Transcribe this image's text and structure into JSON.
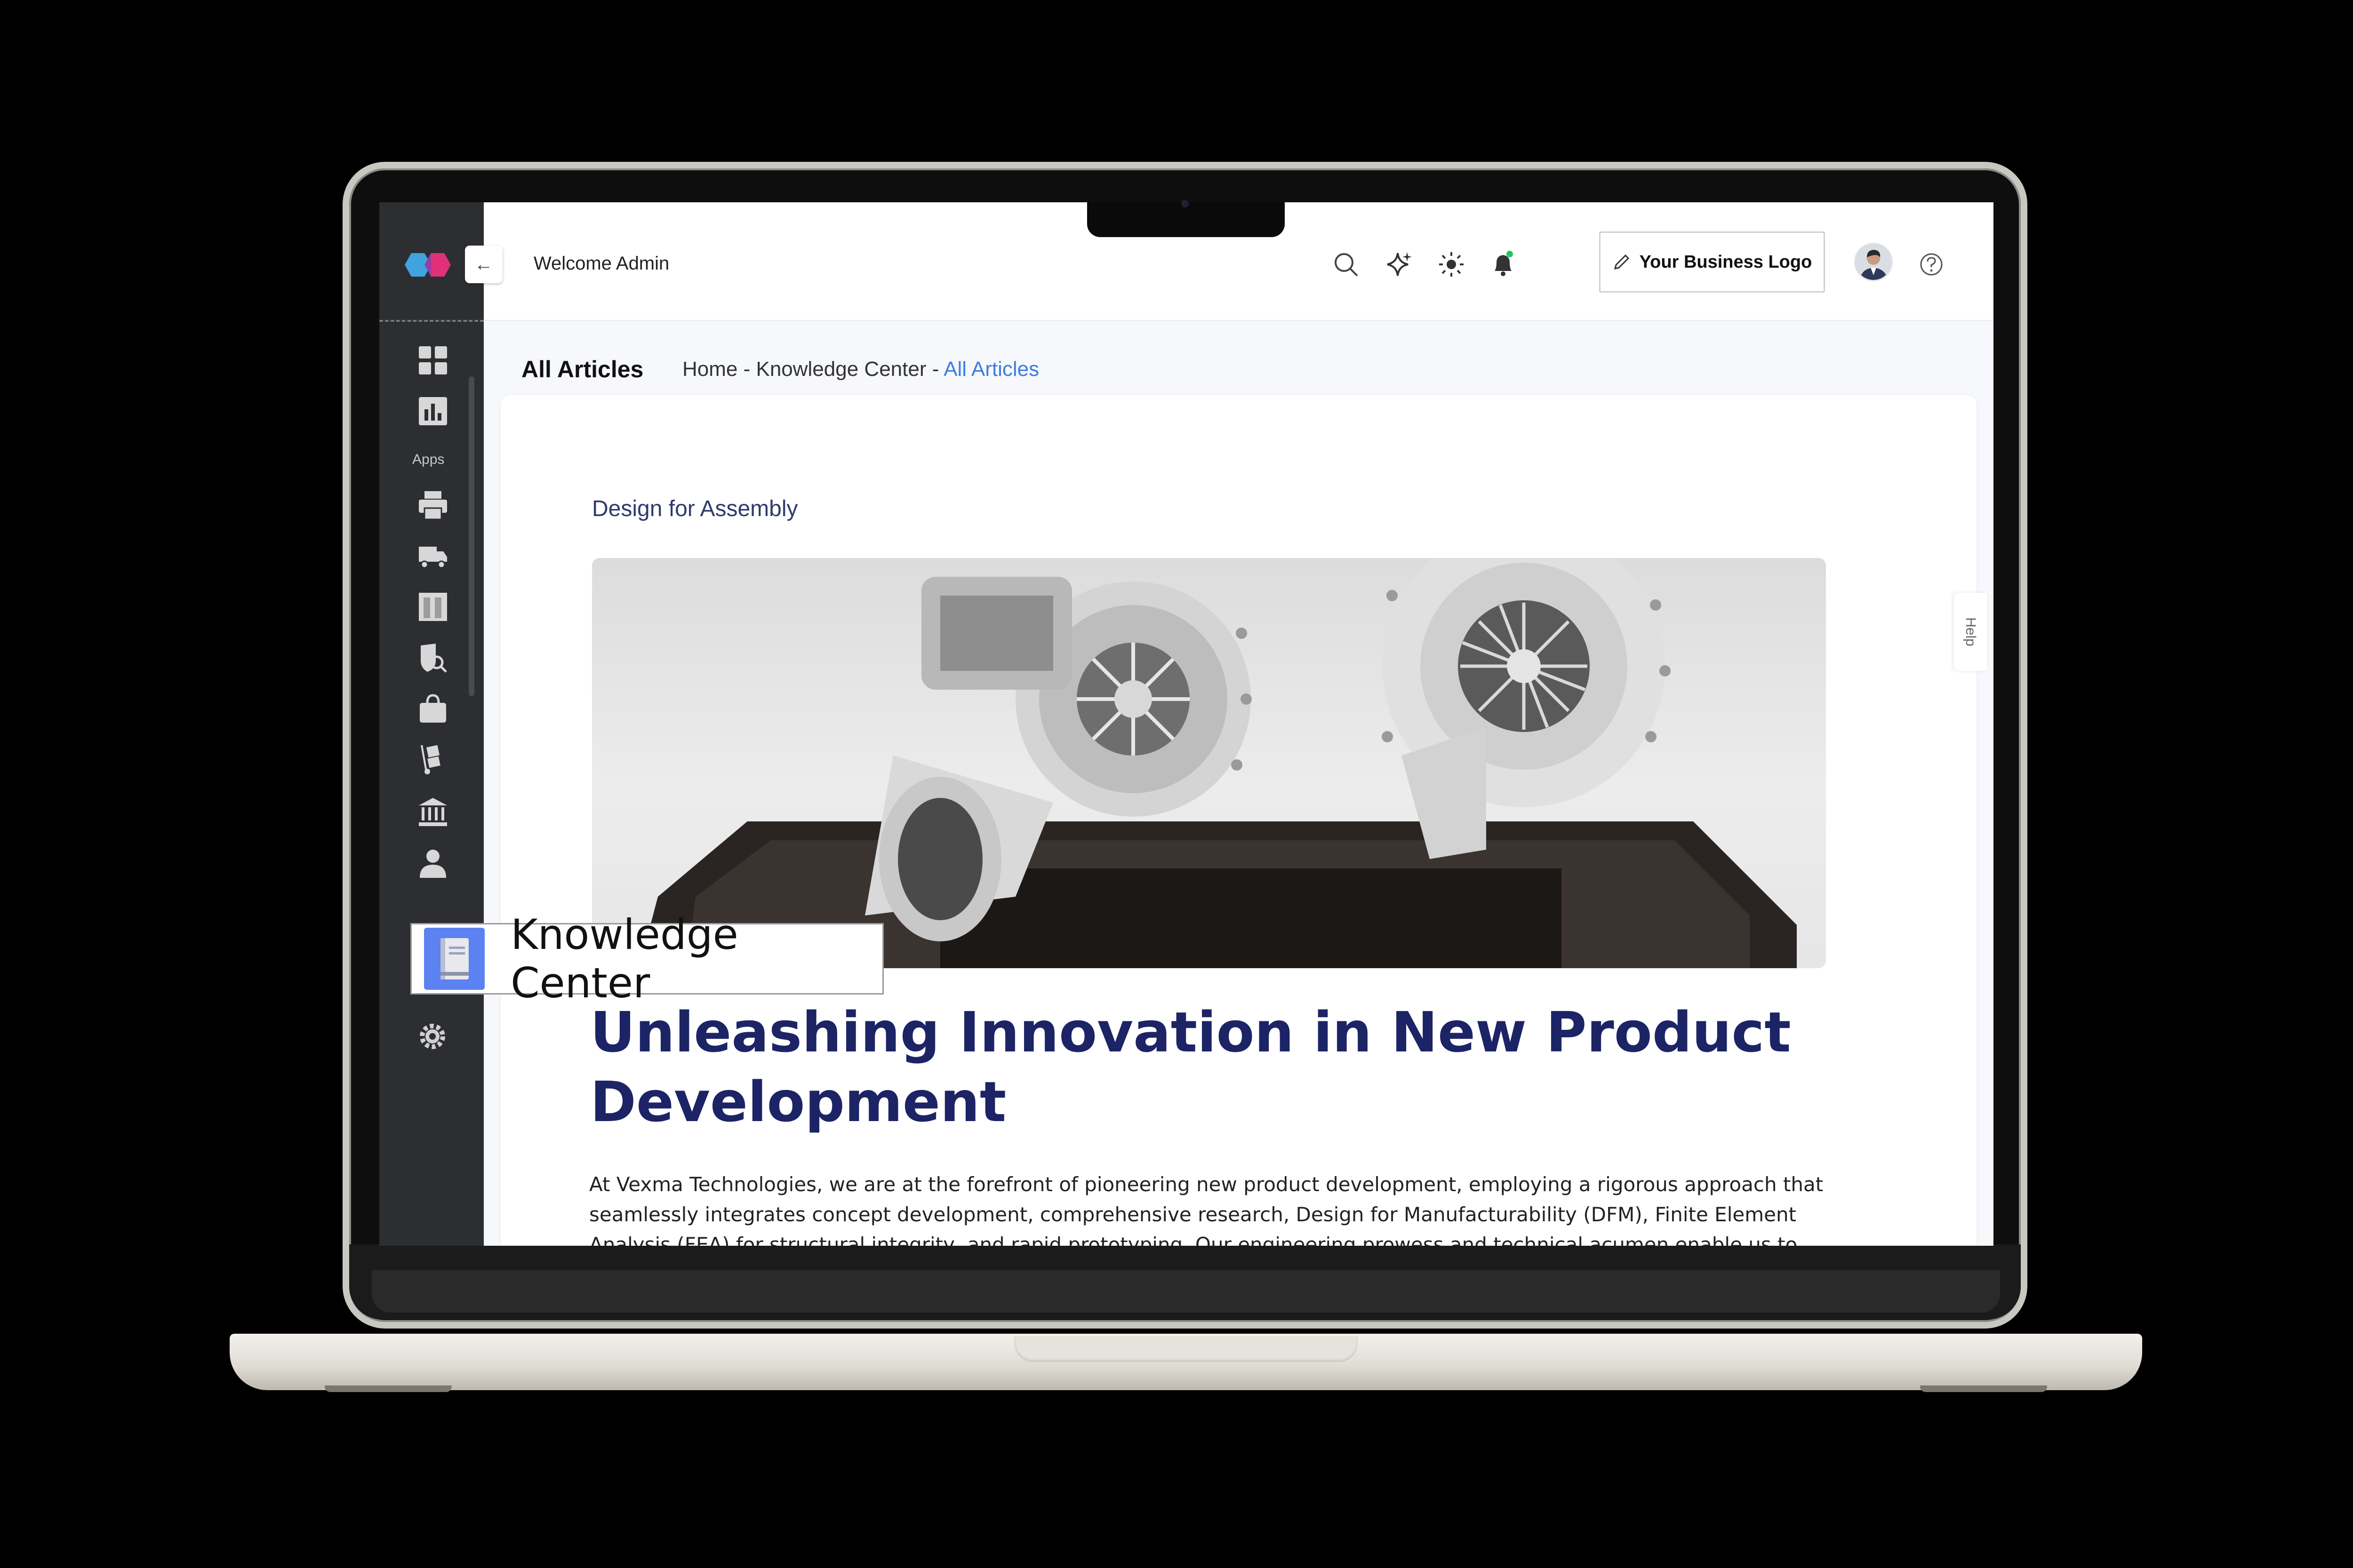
{
  "header": {
    "welcome_text": "Welcome Admin",
    "business_logo_label": "Your Business Logo"
  },
  "sidebar": {
    "section_label": "Apps",
    "active_item_label": "Knowledge Center",
    "icons": [
      "dashboard-icon",
      "reports-icon",
      "printer-icon",
      "truck-icon",
      "columns-icon",
      "search-shield-icon",
      "bag-icon",
      "hand-truck-icon",
      "bank-icon",
      "user-icon",
      "book-icon",
      "gear-icon"
    ]
  },
  "page": {
    "title": "All Articles",
    "breadcrumb": {
      "home": "Home",
      "separator": " - ",
      "section": "Knowledge Center",
      "current": "All Articles"
    }
  },
  "article": {
    "category": "Design for Assembly",
    "headline": "Unleashing Innovation in New Product Development",
    "body": "At Vexma Technologies, we are at the forefront of pioneering new product development, employing a rigorous approach that seamlessly integrates concept development, comprehensive research, Design for Manufacturability (DFM), Finite Element Analysis (FEA) for structural integrity, and rapid prototyping. Our engineering prowess and technical acumen enable us to navigate the"
  },
  "help_tab": {
    "label": "Help"
  },
  "colors": {
    "accent": "#3b7de0",
    "headline": "#1c2466",
    "sidebar_bg": "#2d2e31",
    "kc_icon_bg": "#5b82f0",
    "notification_dot": "#22c55e"
  }
}
